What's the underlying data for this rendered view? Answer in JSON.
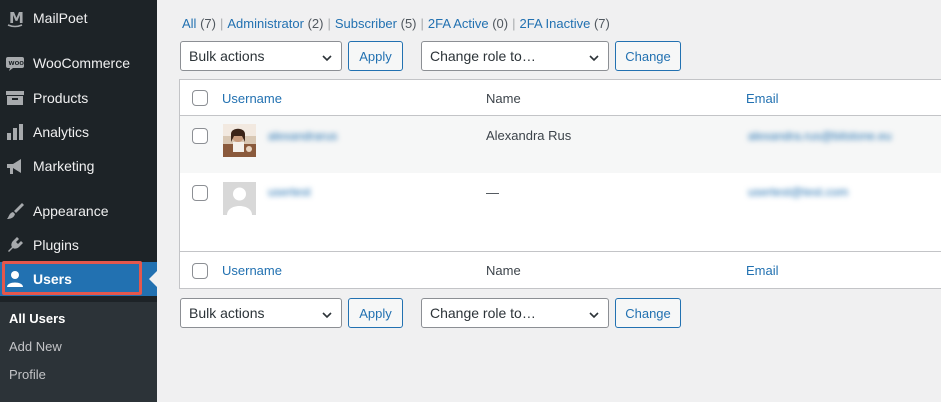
{
  "sidebar": {
    "items": [
      {
        "label": "MailPoet",
        "icon": "mailpoet-icon"
      },
      {
        "label": "WooCommerce",
        "icon": "woocommerce-icon"
      },
      {
        "label": "Products",
        "icon": "archive-icon"
      },
      {
        "label": "Analytics",
        "icon": "bar-chart-icon"
      },
      {
        "label": "Marketing",
        "icon": "megaphone-icon"
      },
      {
        "label": "Appearance",
        "icon": "paintbrush-icon"
      },
      {
        "label": "Plugins",
        "icon": "plug-icon"
      },
      {
        "label": "Users",
        "icon": "user-icon",
        "active": true
      }
    ],
    "submenu": [
      "All Users",
      "Add New",
      "Profile"
    ],
    "accent": "#2271b1",
    "highlight_outline": "#e4574c"
  },
  "filters": [
    {
      "label": "All",
      "count": "(7)"
    },
    {
      "label": "Administrator",
      "count": "(2)"
    },
    {
      "label": "Subscriber",
      "count": "(5)"
    },
    {
      "label": "2FA Active",
      "count": "(0)"
    },
    {
      "label": "2FA Inactive",
      "count": "(7)"
    }
  ],
  "actions": {
    "bulk": "Bulk actions",
    "apply": "Apply",
    "role": "Change role to…",
    "change": "Change"
  },
  "table": {
    "columns": [
      "Username",
      "Name",
      "Email"
    ],
    "rows": [
      {
        "username": "alexandrarus",
        "name": "Alexandra Rus",
        "email": "alexandra.rus@bitstone.eu"
      },
      {
        "username": "usertest",
        "name": "—",
        "email": "usertest@test.com"
      }
    ]
  }
}
